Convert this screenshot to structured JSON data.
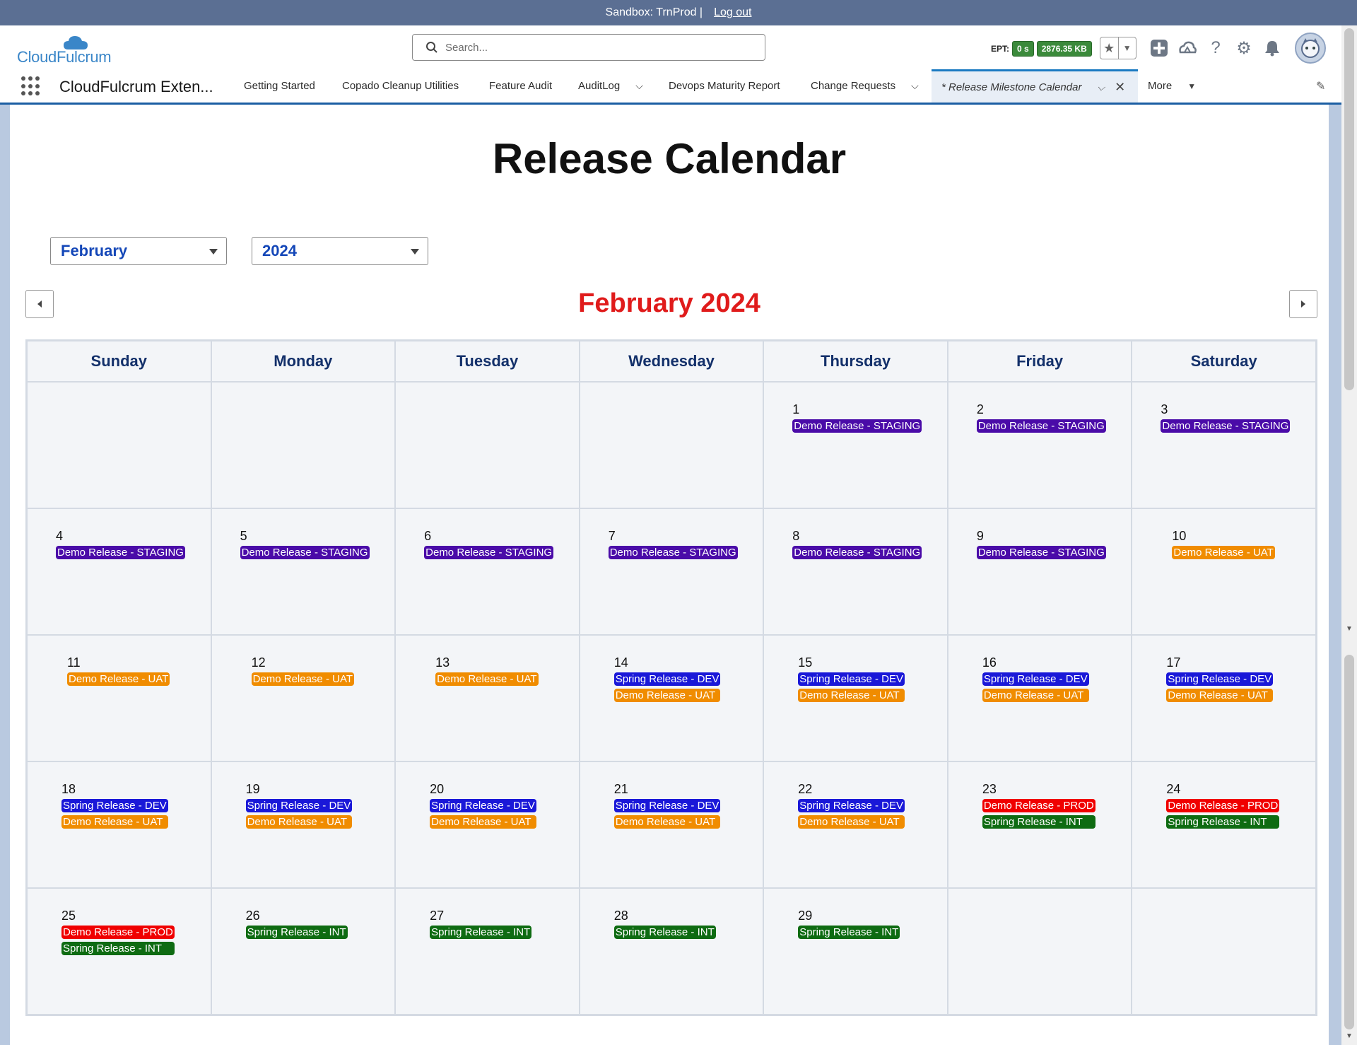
{
  "banner": {
    "text": "Sandbox: TrnProd |",
    "logout": "Log out"
  },
  "header": {
    "logo": "CloudFulcrum",
    "search_placeholder": "Search...",
    "ept_label": "EPT:",
    "ept_time": "0 s",
    "ept_size": "2876.35 KB"
  },
  "nav": {
    "app_name": "CloudFulcrum Exten...",
    "items": [
      "Getting Started",
      "Copado Cleanup Utilities",
      "Feature Audit",
      "AuditLog",
      "Devops Maturity Report",
      "Change Requests"
    ],
    "active_tab": "* Release Milestone Calendar",
    "more": "More"
  },
  "page": {
    "title": "Release Calendar",
    "month_select": "February",
    "year_select": "2024",
    "month_title": "February 2024"
  },
  "colors": {
    "staging": "#4a0ba8",
    "uat": "#f08c00",
    "dev": "#1a18d8",
    "prod": "#f00000",
    "int": "#0e6b12"
  },
  "weekdays": [
    "Sunday",
    "Monday",
    "Tuesday",
    "Wednesday",
    "Thursday",
    "Friday",
    "Saturday"
  ],
  "calendar": [
    {
      "day": "",
      "events": []
    },
    {
      "day": "",
      "events": []
    },
    {
      "day": "",
      "events": []
    },
    {
      "day": "",
      "events": []
    },
    {
      "day": "1",
      "events": [
        {
          "label": "Demo Release - STAGING",
          "type": "staging"
        }
      ]
    },
    {
      "day": "2",
      "events": [
        {
          "label": "Demo Release - STAGING",
          "type": "staging"
        }
      ]
    },
    {
      "day": "3",
      "events": [
        {
          "label": "Demo Release - STAGING",
          "type": "staging"
        }
      ]
    },
    {
      "day": "4",
      "events": [
        {
          "label": "Demo Release - STAGING",
          "type": "staging"
        }
      ]
    },
    {
      "day": "5",
      "events": [
        {
          "label": "Demo Release - STAGING",
          "type": "staging"
        }
      ]
    },
    {
      "day": "6",
      "events": [
        {
          "label": "Demo Release - STAGING",
          "type": "staging"
        }
      ]
    },
    {
      "day": "7",
      "events": [
        {
          "label": "Demo Release - STAGING",
          "type": "staging"
        }
      ]
    },
    {
      "day": "8",
      "events": [
        {
          "label": "Demo Release - STAGING",
          "type": "staging"
        }
      ]
    },
    {
      "day": "9",
      "events": [
        {
          "label": "Demo Release - STAGING",
          "type": "staging"
        }
      ]
    },
    {
      "day": "10",
      "events": [
        {
          "label": "Demo Release - UAT",
          "type": "uat"
        }
      ]
    },
    {
      "day": "11",
      "events": [
        {
          "label": "Demo Release - UAT",
          "type": "uat"
        }
      ]
    },
    {
      "day": "12",
      "events": [
        {
          "label": "Demo Release - UAT",
          "type": "uat"
        }
      ]
    },
    {
      "day": "13",
      "events": [
        {
          "label": "Demo Release - UAT",
          "type": "uat"
        }
      ]
    },
    {
      "day": "14",
      "events": [
        {
          "label": "Spring Release - DEV",
          "type": "dev"
        },
        {
          "label": "Demo Release - UAT",
          "type": "uat"
        }
      ]
    },
    {
      "day": "15",
      "events": [
        {
          "label": "Spring Release - DEV",
          "type": "dev"
        },
        {
          "label": "Demo Release - UAT",
          "type": "uat"
        }
      ]
    },
    {
      "day": "16",
      "events": [
        {
          "label": "Spring Release - DEV",
          "type": "dev"
        },
        {
          "label": "Demo Release - UAT",
          "type": "uat"
        }
      ]
    },
    {
      "day": "17",
      "events": [
        {
          "label": "Spring Release - DEV",
          "type": "dev"
        },
        {
          "label": "Demo Release - UAT",
          "type": "uat"
        }
      ]
    },
    {
      "day": "18",
      "events": [
        {
          "label": "Spring Release - DEV",
          "type": "dev"
        },
        {
          "label": "Demo Release - UAT",
          "type": "uat"
        }
      ]
    },
    {
      "day": "19",
      "events": [
        {
          "label": "Spring Release - DEV",
          "type": "dev"
        },
        {
          "label": "Demo Release - UAT",
          "type": "uat"
        }
      ]
    },
    {
      "day": "20",
      "events": [
        {
          "label": "Spring Release - DEV",
          "type": "dev"
        },
        {
          "label": "Demo Release - UAT",
          "type": "uat"
        }
      ]
    },
    {
      "day": "21",
      "events": [
        {
          "label": "Spring Release - DEV",
          "type": "dev"
        },
        {
          "label": "Demo Release - UAT",
          "type": "uat"
        }
      ]
    },
    {
      "day": "22",
      "events": [
        {
          "label": "Spring Release - DEV",
          "type": "dev"
        },
        {
          "label": "Demo Release - UAT",
          "type": "uat"
        }
      ]
    },
    {
      "day": "23",
      "events": [
        {
          "label": "Demo Release - PROD",
          "type": "prod"
        },
        {
          "label": "Spring Release - INT",
          "type": "int"
        }
      ]
    },
    {
      "day": "24",
      "events": [
        {
          "label": "Demo Release - PROD",
          "type": "prod"
        },
        {
          "label": "Spring Release - INT",
          "type": "int"
        }
      ]
    },
    {
      "day": "25",
      "events": [
        {
          "label": "Demo Release - PROD",
          "type": "prod"
        },
        {
          "label": "Spring Release - INT",
          "type": "int"
        }
      ]
    },
    {
      "day": "26",
      "events": [
        {
          "label": "Spring Release - INT",
          "type": "int"
        }
      ]
    },
    {
      "day": "27",
      "events": [
        {
          "label": "Spring Release - INT",
          "type": "int"
        }
      ]
    },
    {
      "day": "28",
      "events": [
        {
          "label": "Spring Release - INT",
          "type": "int"
        }
      ]
    },
    {
      "day": "29",
      "events": [
        {
          "label": "Spring Release - INT",
          "type": "int"
        }
      ]
    },
    {
      "day": "",
      "events": []
    },
    {
      "day": "",
      "events": []
    }
  ]
}
